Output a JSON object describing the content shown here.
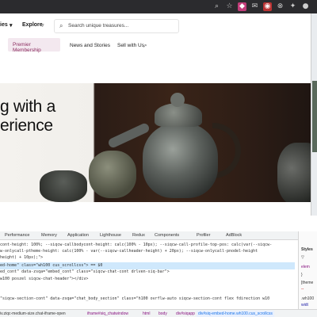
{
  "header": {
    "nav_left_partial": "ies",
    "explore": "Explore",
    "search_placeholder": "Search unique treasures..."
  },
  "subnav": {
    "premium": "Premier Membership",
    "news": "News and Stories",
    "sell": "Sell with Us"
  },
  "hero": {
    "line1": "g with a",
    "line2": "erience"
  },
  "devtools": {
    "tabs": [
      "Performance",
      "Memory",
      "Application",
      "Lighthouse",
      "Redux",
      "Components",
      "Profiler",
      "AdBlock"
    ],
    "code_lines": [
      "cont-height: 100%; --siqcw-callbodycont-height: calc(100% - 10px); --siqcw-call-profile-top-pos: calc(var(--siqcw-",
      "w-onlycall-ptheme-height: calc(100% - var(--siqcw-callheader-height) + 20px); --siqcw-onlycall-pnodel-height",
      "height) + 10px);\">",
      "ed-home\" class=\"wh100 cus_scrollcss\"> == $0",
      "ed_cont\" data-zsqa=\"embed_cont\" class=\"siqcw-chat-cont drlven-siq-bar\">",
      "w100 poszel siqcw-chat-header\"></div>",
      "\"siqcw-section-cont\" data-zsqa=\"chat_body_section\" class=\"h100 ovrflw-auto siqcw-section-cont flex fdirection w10"
    ],
    "styles_tab": "Styles",
    "styles_lines": [
      "elem",
      "}",
      "[theme",
      "--",
      ".wh100",
      "widt"
    ],
    "breadcrumbs": [
      "iv.ziqc-medium-size.chat-iframe-open",
      "iframe#siq_chatwindow",
      "html",
      "body",
      "div#siqapp",
      "div#siq-embed-home.wh100.cus_scrollcss"
    ]
  }
}
